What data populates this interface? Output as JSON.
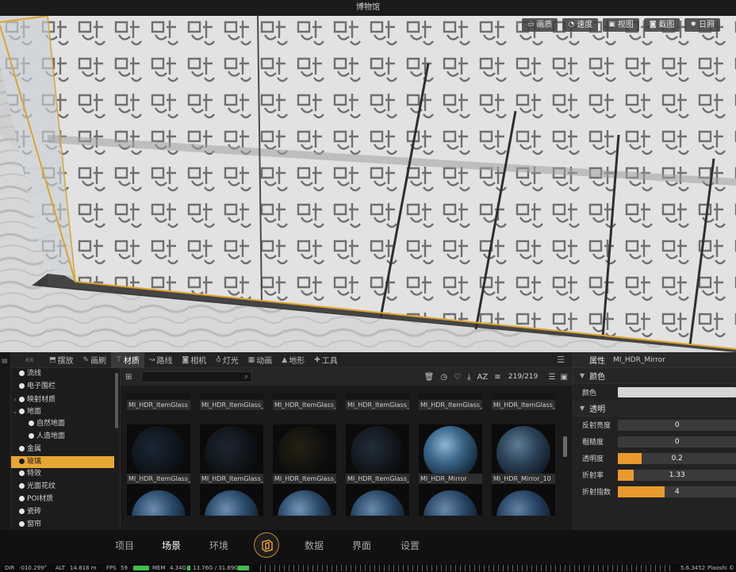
{
  "window": {
    "title": "博物馆"
  },
  "viewport_toolbar": [
    {
      "label": "画质",
      "icon": "monitor-icon"
    },
    {
      "label": "速度",
      "icon": "speed-icon"
    },
    {
      "label": "视图",
      "icon": "view-icon"
    },
    {
      "label": "截图",
      "icon": "camera-icon"
    },
    {
      "label": "日照",
      "icon": "sun-icon"
    }
  ],
  "tree": {
    "items": [
      {
        "label": "流线",
        "level": 0,
        "arrow": ""
      },
      {
        "label": "电子围栏",
        "level": 0,
        "arrow": ""
      },
      {
        "label": "映射材质",
        "level": 0,
        "arrow": "›"
      },
      {
        "label": "地面",
        "level": 0,
        "arrow": "⌄"
      },
      {
        "label": "自然地面",
        "level": 1,
        "arrow": ""
      },
      {
        "label": "人造地面",
        "level": 1,
        "arrow": ""
      },
      {
        "label": "金属",
        "level": 0,
        "arrow": ""
      },
      {
        "label": "玻璃",
        "level": 0,
        "arrow": "",
        "selected": true
      },
      {
        "label": "特效",
        "level": 0,
        "arrow": ""
      },
      {
        "label": "光面花纹",
        "level": 0,
        "arrow": ""
      },
      {
        "label": "POI材质",
        "level": 0,
        "arrow": ""
      },
      {
        "label": "瓷砖",
        "level": 0,
        "arrow": ""
      },
      {
        "label": "窗帘",
        "level": 0,
        "arrow": ""
      }
    ]
  },
  "tabs": {
    "lead": "ex",
    "items": [
      {
        "label": "摆放",
        "icon": "place-icon"
      },
      {
        "label": "画刷",
        "icon": "brush-icon"
      },
      {
        "label": "材质",
        "icon": "material-icon",
        "active": true
      },
      {
        "label": "路线",
        "icon": "route-icon"
      },
      {
        "label": "相机",
        "icon": "camera-icon"
      },
      {
        "label": "灯光",
        "icon": "light-icon"
      },
      {
        "label": "动画",
        "icon": "animation-icon"
      },
      {
        "label": "地形",
        "icon": "terrain-icon"
      },
      {
        "label": "工具",
        "icon": "tool-icon"
      }
    ]
  },
  "grid": {
    "count": "219/219",
    "search_placeholder": "",
    "sort_label": "AZ",
    "top_labels": [
      "MI_HDR_ItemGlass",
      "MI_HDR_ItemGlass_",
      "MI_HDR_ItemGlass_",
      "MI_HDR_ItemGlass_",
      "MI_HDR_ItemGlass_",
      "MI_HDR_ItemGlass_"
    ],
    "mid_labels": [
      "MI_HDR_ItemGlass_",
      "MI_HDR_ItemGlass_",
      "MI_HDR_ItemGlass_",
      "MI_HDR_ItemGlass_",
      "MI_HDR_Mirror",
      "MI_HDR_Mirror_10"
    ]
  },
  "properties": {
    "title": "属性",
    "material_name": "MI_HDR_Mirror",
    "section_color": "颜色",
    "color_label": "颜色",
    "color_value": "#d6d6d6",
    "section_transparency": "透明",
    "rows": [
      {
        "label": "反射亮度",
        "value": "0",
        "fraction": 0
      },
      {
        "label": "粗糙度",
        "value": "0",
        "fraction": 0
      },
      {
        "label": "透明度",
        "value": "0.2",
        "fraction": 0.2
      },
      {
        "label": "折射率",
        "value": "1.33",
        "fraction": 0.133
      },
      {
        "label": "折射指数",
        "value": "4",
        "fraction": 0.4
      }
    ]
  },
  "nav": {
    "items": [
      "项目",
      "场景",
      "环境",
      "数据",
      "界面",
      "设置"
    ],
    "active": "场景"
  },
  "status": {
    "dir": "DIR",
    "dir_val": "-010.299°",
    "alt": "ALT",
    "alt_val": "14.818 m",
    "fps": "FPS",
    "fps_val": "59",
    "mem": "MEM",
    "mem_val": "4.34G",
    "gpu_val": "13.76G / 31.89G",
    "version": "5.6.3452",
    "brand": "Plaoshi ©"
  },
  "colors": {
    "accent": "#e8a634",
    "bar": "#e89a2c"
  }
}
